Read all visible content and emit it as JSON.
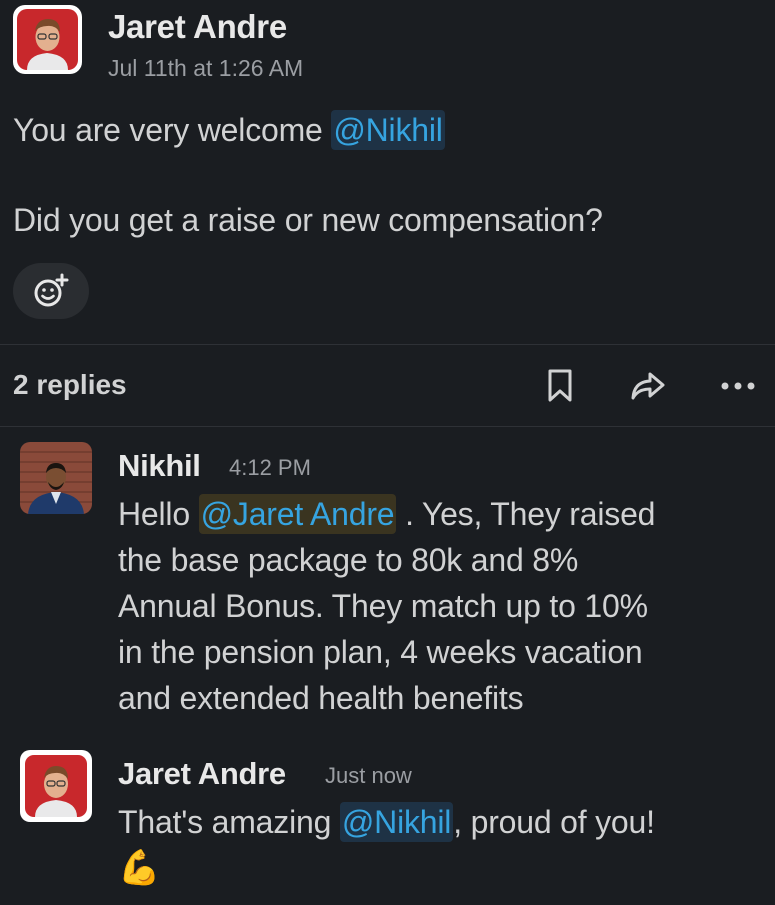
{
  "parent_message": {
    "author": "Jaret Andre",
    "timestamp": "Jul 11th at 1:26 AM",
    "line1_prefix": "You are very welcome ",
    "line1_mention": "@Nikhil",
    "line2": "Did you get a raise or new compensation?",
    "add_reaction_icon": "add-emoji-icon"
  },
  "thread_bar": {
    "replies_label": "2 replies",
    "icons": [
      "bookmark-icon",
      "share-icon",
      "more-icon"
    ]
  },
  "replies": [
    {
      "author": "Nikhil",
      "timestamp": "4:12 PM",
      "text_prefix": "Hello ",
      "mention": "@Jaret Andre",
      "text_lines": [
        " . Yes, They raised",
        "the base package to 80k and 8%",
        "Annual Bonus. They match up to 10%",
        "in the pension plan, 4 weeks vacation",
        "and extended health benefits"
      ]
    },
    {
      "author": "Jaret Andre",
      "timestamp": "Just now",
      "text_prefix": "That's amazing ",
      "mention": "@Nikhil",
      "text_suffix": ", proud of you!",
      "emoji": "💪"
    }
  ],
  "colors": {
    "background": "#1a1d21",
    "mention": "#36a4e0",
    "text": "#d1d2d3",
    "muted": "#9b9ea3"
  }
}
